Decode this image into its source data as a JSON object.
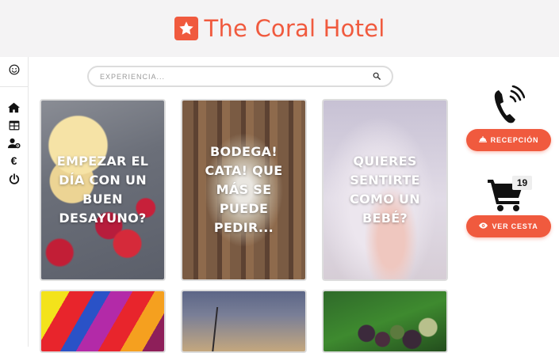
{
  "header": {
    "title": "The Coral Hotel",
    "brand_icon": "star-icon",
    "accent": "#f05a3e"
  },
  "sidebar": {
    "items": [
      {
        "icon": "smiley-icon"
      },
      {
        "icon": "home-icon"
      },
      {
        "icon": "table-icon"
      },
      {
        "icon": "user-settings-icon"
      },
      {
        "icon": "euro-icon"
      },
      {
        "icon": "power-icon"
      }
    ],
    "euro_symbol": "€"
  },
  "search": {
    "placeholder": "EXPERIENCIA...",
    "value": "",
    "icon": "search-icon"
  },
  "cards": [
    {
      "text": "EMPEZAR EL DÍA CON UN BUEN DESAYUNO?"
    },
    {
      "text": "BODEGA! CATA! QUE MÁS SE PUEDE PEDIR..."
    },
    {
      "text": "QUIERES SENTIRTE COMO UN BEBÉ?"
    },
    {
      "text": ""
    },
    {
      "text": ""
    },
    {
      "text": ""
    }
  ],
  "right_panel": {
    "phone_icon": "phone-icon",
    "reception_label": "RECEPCIÓN",
    "reception_icon": "bell-icon",
    "cart_icon": "cart-icon",
    "cart_count": "19",
    "view_cart_label": "VER CESTA",
    "view_cart_icon": "eye-icon"
  }
}
